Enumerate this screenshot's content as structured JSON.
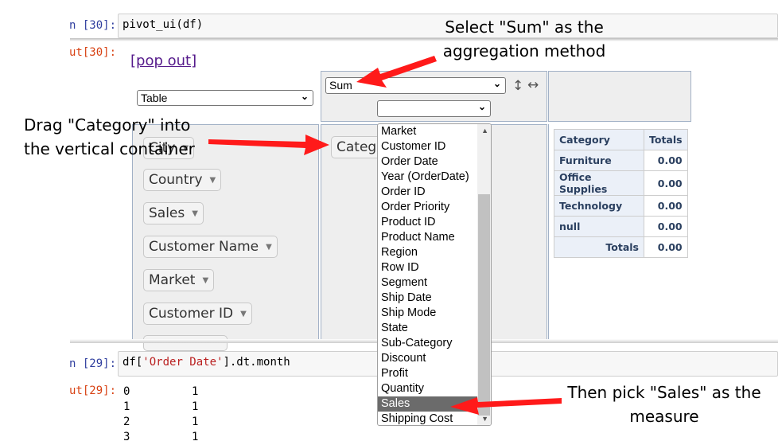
{
  "cells": {
    "cell30": {
      "in_prompt": "n [30]:",
      "code": "pivot_ui(df)",
      "out_prompt": "ut[30]:"
    },
    "cell29": {
      "in_prompt": "n [29]:",
      "code_prefix": "df[",
      "code_string": "'Order Date'",
      "code_suffix": "].dt.month",
      "out_prompt": "ut[29]:"
    }
  },
  "popout": "[pop out]",
  "renderer_select": "Table",
  "aggregator_select": "Sum",
  "sort_icons": {
    "rows": "↕",
    "cols": "↔"
  },
  "attributes": [
    "City",
    "Country",
    "Sales",
    "Customer Name",
    "Market",
    "Customer ID"
  ],
  "row_attribute": "Categ",
  "dropdown_options": [
    "Market",
    "Customer ID",
    "Order Date",
    "Year (OrderDate)",
    "Order ID",
    "Order Priority",
    "Product ID",
    "Product Name",
    "Region",
    "Row ID",
    "Segment",
    "Ship Date",
    "Ship Mode",
    "State",
    "Sub-Category",
    "Discount",
    "Profit",
    "Quantity",
    "Sales",
    "Shipping Cost"
  ],
  "dropdown_selected": "Sales",
  "pivot_table": {
    "header": [
      "Category",
      "Totals"
    ],
    "rows": [
      {
        "label": "Furniture",
        "value": "0.00"
      },
      {
        "label": "Office Supplies",
        "value": "0.00"
      },
      {
        "label": "Technology",
        "value": "0.00"
      },
      {
        "label": "null",
        "value": "0.00"
      }
    ],
    "totals_label": "Totals",
    "totals_value": "0.00"
  },
  "output29": [
    {
      "index": "0",
      "value": "1"
    },
    {
      "index": "1",
      "value": "1"
    },
    {
      "index": "2",
      "value": "1"
    },
    {
      "index": "3",
      "value": "1"
    }
  ],
  "annotations": {
    "sum_line1": "Select \"Sum\" as the",
    "sum_line2": "aggregation method",
    "category_line1": "Drag \"Category\" into",
    "category_line2": "the vertical container",
    "sales_line1": "Then pick \"Sales\" as the",
    "sales_line2": "measure"
  },
  "colors": {
    "annotation_arrow": "#ff1a1a",
    "pane_border": "#a2b1c6",
    "table_header_bg": "#ebf0f8"
  }
}
